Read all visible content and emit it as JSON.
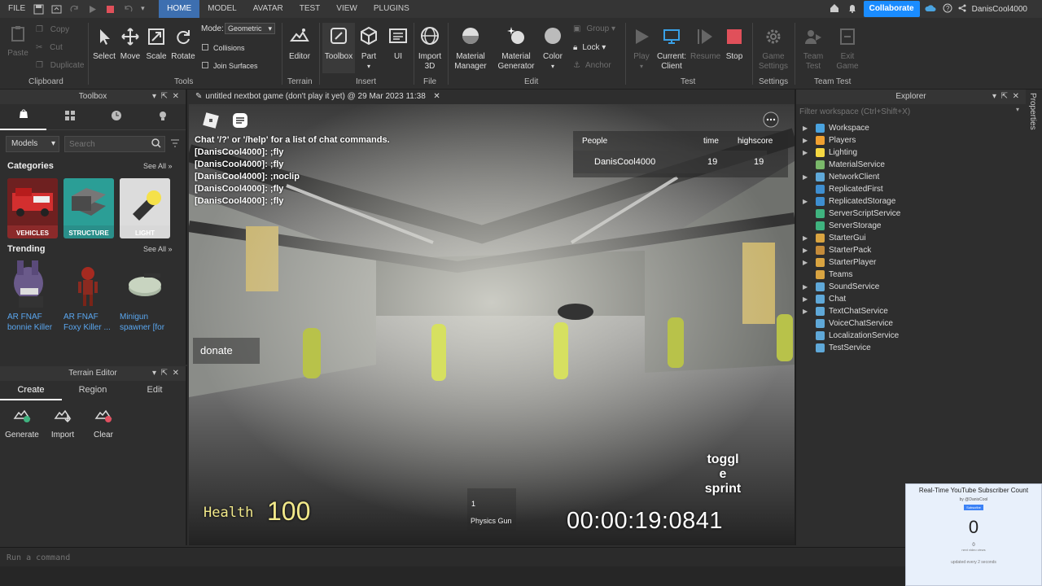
{
  "menubar": {
    "file": "FILE",
    "tabs": [
      "HOME",
      "MODEL",
      "AVATAR",
      "TEST",
      "VIEW",
      "PLUGINS"
    ],
    "collaborate": "Collaborate",
    "username": "DanisCool4000"
  },
  "ribbon": {
    "clipboard": {
      "paste": "Paste",
      "copy": "Copy",
      "cut": "Cut",
      "duplicate": "Duplicate",
      "label": "Clipboard"
    },
    "tools": {
      "select": "Select",
      "move": "Move",
      "scale": "Scale",
      "rotate": "Rotate",
      "mode_label": "Mode:",
      "mode_value": "Geometric",
      "collisions": "Collisions",
      "join_surfaces": "Join Surfaces",
      "label": "Tools"
    },
    "terrain": {
      "editor": "Editor",
      "label": "Terrain"
    },
    "insert": {
      "toolbox": "Toolbox",
      "part": "Part",
      "ui": "UI",
      "label": "Insert"
    },
    "file": {
      "import3d": "Import 3D",
      "label": "File"
    },
    "edit": {
      "material_manager": "Material Manager",
      "material_generator": "Material Generator",
      "color": "Color",
      "group": "Group",
      "lock": "Lock",
      "anchor": "Anchor",
      "label": "Edit"
    },
    "test": {
      "play": "Play",
      "current_client": "Current: Client",
      "resume": "Resume",
      "stop": "Stop",
      "label": "Test"
    },
    "settings": {
      "game_settings": "Game Settings",
      "label": "Settings"
    },
    "team_test": {
      "team_test": "Team Test",
      "exit_game": "Exit Game",
      "label": "Team Test"
    }
  },
  "toolbox": {
    "title": "Toolbox",
    "models_dropdown": "Models",
    "search_placeholder": "Search",
    "categories_title": "Categories",
    "see_all": "See All »",
    "categories": [
      "VEHICLES",
      "STRUCTURE",
      "LIGHT"
    ],
    "trending_title": "Trending",
    "trending": [
      {
        "line1": "AR FNAF",
        "line2": "bonnie Killer"
      },
      {
        "line1": "AR FNAF",
        "line2": "Foxy Killer ..."
      },
      {
        "line1": "Minigun",
        "line2": "spawner [for"
      }
    ]
  },
  "terrain_editor": {
    "title": "Terrain Editor",
    "tabs": [
      "Create",
      "Region",
      "Edit"
    ],
    "tools": [
      "Generate",
      "Import",
      "Clear"
    ]
  },
  "document_tab": {
    "title": "untitled nextbot game (don't play it yet) @ 29 Mar 2023 11:38"
  },
  "game": {
    "chat_lines": [
      "Chat '/?' or '/help' for a list of chat commands.",
      "[DanisCool4000]: ;fly",
      "[DanisCool4000]: ;fly",
      "[DanisCool4000]: ;noclip",
      "[DanisCool4000]: ;fly",
      "[DanisCool4000]: ;fly"
    ],
    "leaderboard": {
      "headers": [
        "People",
        "time",
        "highscore"
      ],
      "rows": [
        {
          "name": "DanisCool4000",
          "time": "19",
          "highscore": "19"
        }
      ]
    },
    "donate": "donate",
    "toggle_sprint": [
      "toggl",
      "e",
      "sprint"
    ],
    "health_label": "Health",
    "health_value": "100",
    "hotbar_slot": "1",
    "hotbar_item": "Physics Gun",
    "timer": "00:00:19:0841"
  },
  "explorer": {
    "title": "Explorer",
    "filter_placeholder": "Filter workspace (Ctrl+Shift+X)",
    "items": [
      {
        "label": "Workspace",
        "expandable": true,
        "color": "#4aa3df"
      },
      {
        "label": "Players",
        "expandable": true,
        "color": "#f0a030"
      },
      {
        "label": "Lighting",
        "expandable": true,
        "color": "#f5d742"
      },
      {
        "label": "MaterialService",
        "expandable": false,
        "color": "#7ab86a"
      },
      {
        "label": "NetworkClient",
        "expandable": true,
        "color": "#5fa8d8"
      },
      {
        "label": "ReplicatedFirst",
        "expandable": false,
        "color": "#3e8ed0"
      },
      {
        "label": "ReplicatedStorage",
        "expandable": true,
        "color": "#3e8ed0"
      },
      {
        "label": "ServerScriptService",
        "expandable": false,
        "color": "#3fb37f"
      },
      {
        "label": "ServerStorage",
        "expandable": false,
        "color": "#3fb37f"
      },
      {
        "label": "StarterGui",
        "expandable": true,
        "color": "#d9a441"
      },
      {
        "label": "StarterPack",
        "expandable": true,
        "color": "#c48b3a"
      },
      {
        "label": "StarterPlayer",
        "expandable": true,
        "color": "#d9a441"
      },
      {
        "label": "Teams",
        "expandable": false,
        "color": "#d9a441"
      },
      {
        "label": "SoundService",
        "expandable": true,
        "color": "#5fa8d8"
      },
      {
        "label": "Chat",
        "expandable": true,
        "color": "#5fa8d8"
      },
      {
        "label": "TextChatService",
        "expandable": true,
        "color": "#5fa8d8"
      },
      {
        "label": "VoiceChatService",
        "expandable": false,
        "color": "#5fa8d8"
      },
      {
        "label": "LocalizationService",
        "expandable": false,
        "color": "#5fa8d8"
      },
      {
        "label": "TestService",
        "expandable": false,
        "color": "#5fa8d8"
      }
    ]
  },
  "properties_tab": "Properties",
  "command_bar": {
    "placeholder": "Run a command"
  },
  "overlay": {
    "title": "Real-Time YouTube Subscriber Count",
    "channel": "by @DanisCool",
    "subscribe": "Subscribe",
    "count": "0",
    "goal": "0",
    "goal_label": "next video views",
    "updated": "updated every 2 seconds"
  }
}
